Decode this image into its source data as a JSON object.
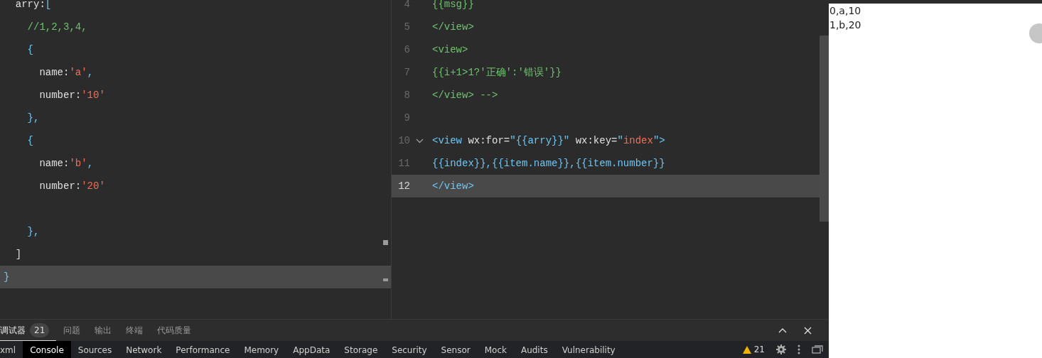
{
  "left_editor": {
    "lines": [
      {
        "current": false,
        "tokens": [
          {
            "text": "  arry:",
            "kind": "plain"
          },
          {
            "text": "[",
            "kind": "punct"
          }
        ]
      },
      {
        "current": false,
        "tokens": [
          {
            "text": "    //1,2,3,4,",
            "kind": "comment"
          }
        ]
      },
      {
        "current": false,
        "tokens": [
          {
            "text": "    {",
            "kind": "punct"
          }
        ]
      },
      {
        "current": false,
        "tokens": [
          {
            "text": "      name:",
            "kind": "plain"
          },
          {
            "text": "'a'",
            "kind": "string"
          },
          {
            "text": ",",
            "kind": "punct"
          }
        ]
      },
      {
        "current": false,
        "tokens": [
          {
            "text": "      number:",
            "kind": "plain"
          },
          {
            "text": "'10'",
            "kind": "string"
          }
        ]
      },
      {
        "current": false,
        "tokens": [
          {
            "text": "    },",
            "kind": "punct"
          }
        ]
      },
      {
        "current": false,
        "tokens": [
          {
            "text": "    {",
            "kind": "punct"
          }
        ]
      },
      {
        "current": false,
        "tokens": [
          {
            "text": "      name:",
            "kind": "plain"
          },
          {
            "text": "'b'",
            "kind": "string"
          },
          {
            "text": ",",
            "kind": "punct"
          }
        ]
      },
      {
        "current": false,
        "tokens": [
          {
            "text": "      number:",
            "kind": "plain"
          },
          {
            "text": "'20'",
            "kind": "string"
          }
        ]
      },
      {
        "current": false
      },
      {
        "current": false,
        "tokens": [
          {
            "text": "    },",
            "kind": "punct"
          }
        ]
      },
      {
        "current": false,
        "tokens": [
          {
            "text": "  ]",
            "kind": "plain"
          }
        ]
      },
      {
        "current": true,
        "tokens": [
          {
            "text": "}",
            "kind": "punct"
          }
        ]
      }
    ]
  },
  "right_editor": {
    "lines": [
      {
        "number": "4",
        "current": false,
        "fold": false,
        "tokens": [
          {
            "text": "{{msg}}",
            "kind": "comment"
          }
        ]
      },
      {
        "number": "5",
        "current": false,
        "fold": false,
        "tokens": [
          {
            "text": "</view>",
            "kind": "comment"
          }
        ]
      },
      {
        "number": "6",
        "current": false,
        "fold": false,
        "tokens": [
          {
            "text": "<view>",
            "kind": "comment"
          }
        ]
      },
      {
        "number": "7",
        "current": false,
        "fold": false,
        "tokens": [
          {
            "text": "{{i+1>1?'正确':'错误'}}",
            "kind": "comment"
          }
        ]
      },
      {
        "number": "8",
        "current": false,
        "fold": false,
        "tokens": [
          {
            "text": "</view> -->",
            "kind": "comment"
          }
        ]
      },
      {
        "number": "9",
        "current": false,
        "fold": false
      },
      {
        "number": "10",
        "current": false,
        "fold": true,
        "tokens": [
          {
            "text": "<view",
            "kind": "tag"
          },
          {
            "text": " wx:for=",
            "kind": "plain"
          },
          {
            "text": "\"{{arry}}\"",
            "kind": "tag"
          },
          {
            "text": " wx:key=",
            "kind": "plain"
          },
          {
            "text": "\"",
            "kind": "tag"
          },
          {
            "text": "index",
            "kind": "string"
          },
          {
            "text": "\">",
            "kind": "tag"
          }
        ]
      },
      {
        "number": "11",
        "current": false,
        "fold": false,
        "tokens": [
          {
            "text": "{{index}},{{item.name}},{{item.number}}",
            "kind": "tag"
          }
        ]
      },
      {
        "number": "12",
        "current": true,
        "fold": false,
        "tokens": [
          {
            "text": "</view>",
            "kind": "tag"
          }
        ]
      }
    ]
  },
  "panel_tabs": [
    {
      "label": "调试器",
      "badge": "21",
      "selected": true
    },
    {
      "label": "问题",
      "selected": false
    },
    {
      "label": "输出",
      "selected": false
    },
    {
      "label": "终端",
      "selected": false
    },
    {
      "label": "代码质量",
      "selected": false
    }
  ],
  "devtools_tabs": [
    {
      "label": "xml",
      "selected": false
    },
    {
      "label": "Console",
      "selected": true
    },
    {
      "label": "Sources",
      "selected": false
    },
    {
      "label": "Network",
      "selected": false
    },
    {
      "label": "Performance",
      "selected": false
    },
    {
      "label": "Memory",
      "selected": false
    },
    {
      "label": "AppData",
      "selected": false
    },
    {
      "label": "Storage",
      "selected": false
    },
    {
      "label": "Security",
      "selected": false
    },
    {
      "label": "Sensor",
      "selected": false
    },
    {
      "label": "Mock",
      "selected": false
    },
    {
      "label": "Audits",
      "selected": false
    },
    {
      "label": "Vulnerability",
      "selected": false
    }
  ],
  "warning_count": "21",
  "preview": {
    "lines": [
      "0,a,10",
      "1,b,20"
    ]
  }
}
